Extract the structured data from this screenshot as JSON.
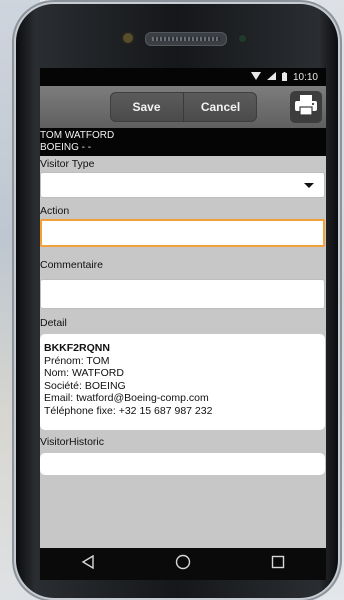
{
  "status_bar": {
    "time": "10:10",
    "icons": [
      "wifi-icon",
      "signal-icon",
      "battery-icon"
    ]
  },
  "toolbar": {
    "save_label": "Save",
    "cancel_label": "Cancel",
    "print_icon": "printer-icon"
  },
  "visitor": {
    "name": "TOM WATFORD",
    "company_line": "BOEING - -"
  },
  "form": {
    "visitor_type_label": "Visitor Type",
    "visitor_type_value": "",
    "action_label": "Action",
    "action_value": "",
    "comment_label": "Commentaire",
    "comment_value": "",
    "detail_label": "Detail",
    "detail": {
      "code": "BKKF2RQNN",
      "prenom": "Prénom: TOM",
      "nom": "Nom: WATFORD",
      "societe": "Société: BOEING",
      "email": "Email: twatford@Boeing-comp.com",
      "telephone": "Téléphone fixe: +32 15 687 987 232"
    },
    "history_label": "VisitorHistoric",
    "history_value": ""
  },
  "colors": {
    "focus_border": "#f2a13a",
    "toolbar_bg": "#6e6e6e",
    "screen_bg": "#c7c7c7"
  }
}
